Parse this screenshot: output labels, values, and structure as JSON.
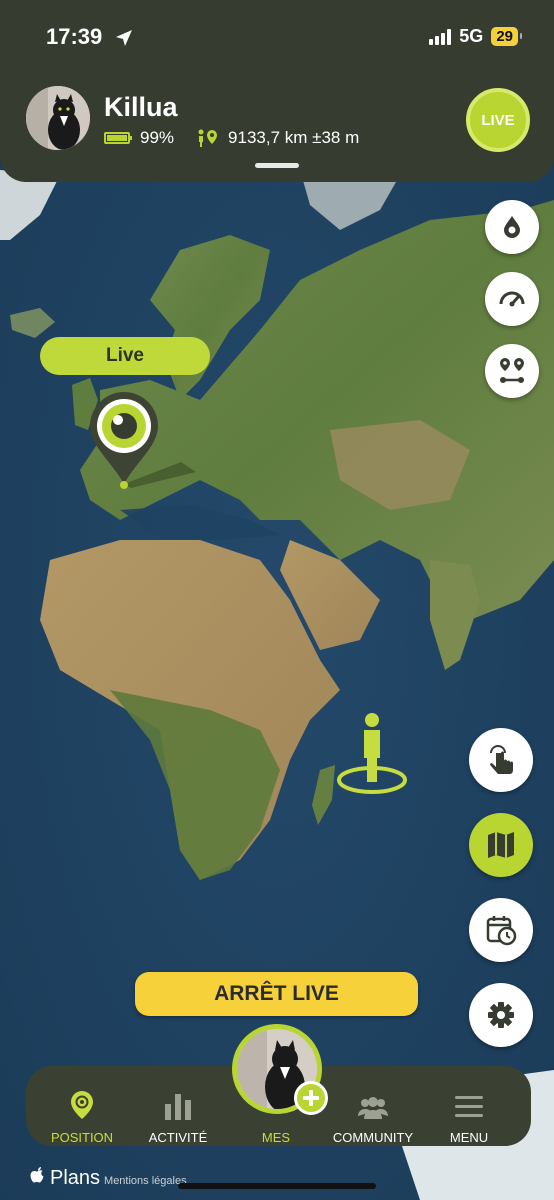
{
  "status_bar": {
    "time": "17:39",
    "network": "5G",
    "battery": "29"
  },
  "pet": {
    "name": "Killua",
    "battery": "99%",
    "distance": "9133,7 km ±38 m"
  },
  "header": {
    "live_badge": "LIVE"
  },
  "map": {
    "live_label": "Live",
    "stop_live_button": "ARRÊT LIVE",
    "attribution_brand": "Plans",
    "attribution_legal": "Mentions légales"
  },
  "side_buttons": [
    {
      "icon": "drop-icon"
    },
    {
      "icon": "speedometer-icon"
    },
    {
      "icon": "route-icon"
    },
    {
      "icon": "touch-icon"
    },
    {
      "icon": "map-icon"
    },
    {
      "icon": "calendar-clock-icon"
    },
    {
      "icon": "gear-icon"
    }
  ],
  "nav": {
    "position": "POSITION",
    "activity": "ACTIVITÉ",
    "mine": "MES",
    "community": "COMMUNITY",
    "menu": "MENU"
  },
  "colors": {
    "accent": "#b9d531",
    "header_bg": "#363d30",
    "stop_button": "#f7d13a",
    "ocean": "#1f4260"
  }
}
